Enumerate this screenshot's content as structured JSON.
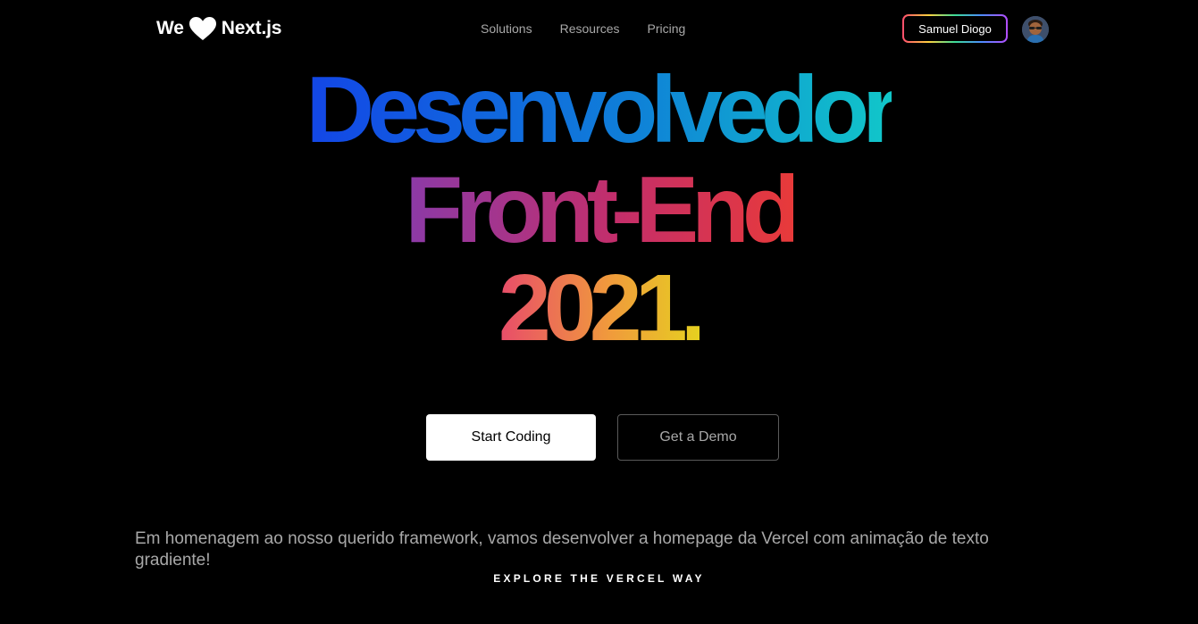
{
  "header": {
    "logo": {
      "before": "We",
      "icon": "heart-icon",
      "after": "Next.js"
    },
    "nav": [
      {
        "label": "Solutions"
      },
      {
        "label": "Resources"
      },
      {
        "label": "Pricing"
      }
    ],
    "user_button_label": "Samuel Diogo",
    "avatar_icon": "avatar-icon"
  },
  "hero": {
    "line1": "Desenvolvedor",
    "line2": "Front-End",
    "line3": "2021."
  },
  "buttons": {
    "primary_label": "Start Coding",
    "secondary_label": "Get a Demo"
  },
  "description": "Em homenagem ao nosso querido framework, vamos desenvolver a homepage da Vercel com animação de texto gradiente!",
  "explore_label": "EXPLORE THE VERCEL WAY",
  "colors": {
    "background": "#000000",
    "line1_gradient": [
      "#1346e6",
      "#11c7c9"
    ],
    "line2_gradient": [
      "#8b3aa8",
      "#e83a3a"
    ],
    "line3_gradient": [
      "#e84c6a",
      "#e6d020"
    ]
  }
}
